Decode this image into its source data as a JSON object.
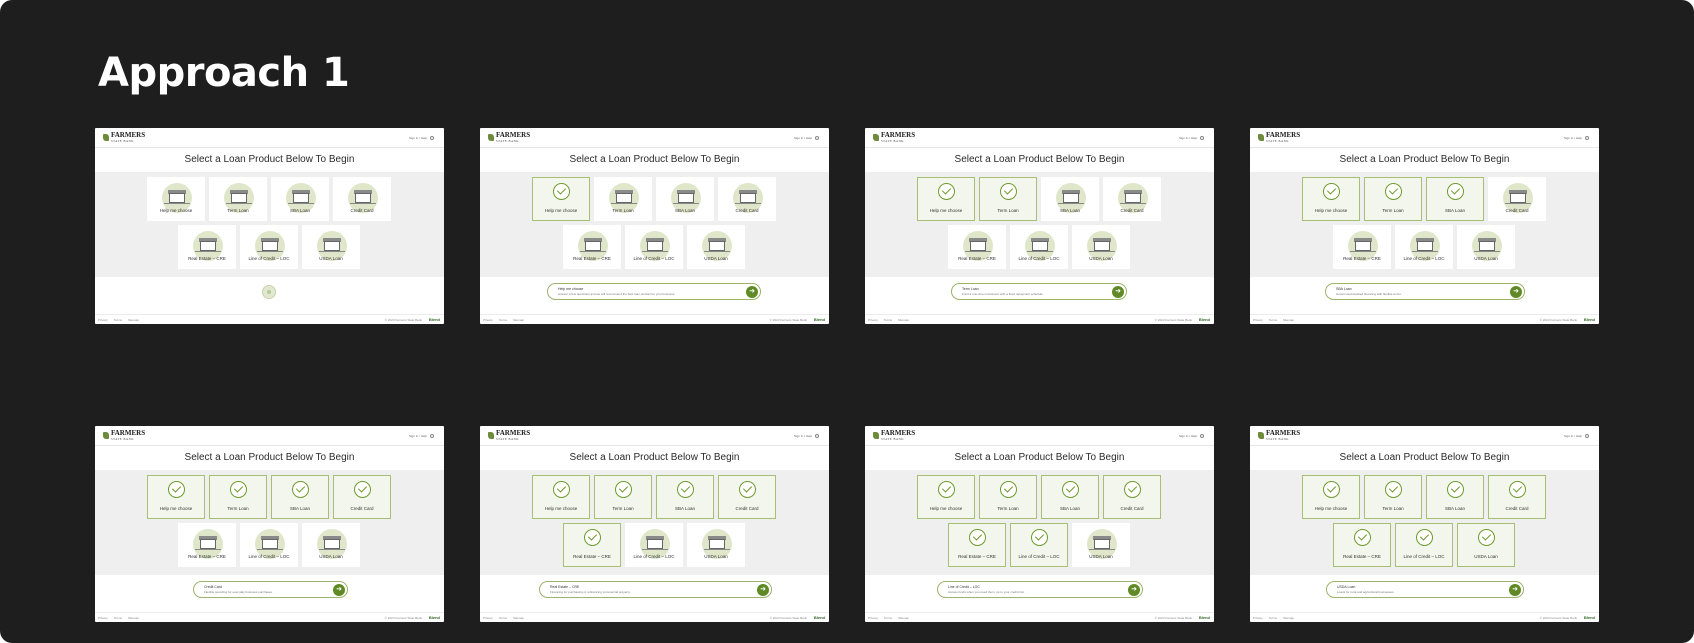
{
  "board": {
    "title": "Approach 1"
  },
  "page": {
    "logo_text": "FARMERS",
    "logo_sub": "STATE BANK",
    "header_link": "Sign In / Help",
    "heading": "Select a Loan Product Below To Begin",
    "footer_links": [
      "Privacy",
      "Terms",
      "Sitemap"
    ],
    "copyright": "© 2023 Farmers State Bank",
    "powered_by": "Blend"
  },
  "products": [
    "Help me choose",
    "Term Loan",
    "SBA Loan",
    "Credit Card",
    "Real Estate – CRE",
    "Line of Credit – LOC",
    "USDA Loan"
  ],
  "frames": [
    {
      "selected": [],
      "loading": true,
      "pill": null
    },
    {
      "selected": [
        0
      ],
      "loading": false,
      "pill": {
        "title": "Help me choose",
        "desc": "Answer a few questions and we will recommend the best loan product for your business."
      }
    },
    {
      "selected": [
        0,
        1
      ],
      "loading": false,
      "pill": {
        "title": "Term Loan",
        "desc": "Fund a one-time investment with a fixed repayment schedule."
      }
    },
    {
      "selected": [
        0,
        1,
        2
      ],
      "loading": false,
      "pill": {
        "title": "SBA Loan",
        "desc": "Government-backed financing with flexible terms."
      }
    },
    {
      "selected": [
        0,
        1,
        2,
        3
      ],
      "loading": false,
      "pill": {
        "title": "Credit Card",
        "desc": "Flexible spending for everyday business purchases."
      }
    },
    {
      "selected": [
        0,
        1,
        2,
        3,
        4
      ],
      "loading": false,
      "pill": {
        "title": "Real Estate – CRE",
        "desc": "Financing for purchasing or refinancing commercial property."
      }
    },
    {
      "selected": [
        0,
        1,
        2,
        3,
        4,
        5
      ],
      "loading": false,
      "pill": {
        "title": "Line of Credit – LOC",
        "desc": "Access funds when you need them, up to your credit limit."
      }
    },
    {
      "selected": [
        0,
        1,
        2,
        3,
        4,
        5,
        6
      ],
      "loading": false,
      "pill": {
        "title": "USDA Loan",
        "desc": "Loans for rural and agricultural businesses."
      }
    }
  ]
}
